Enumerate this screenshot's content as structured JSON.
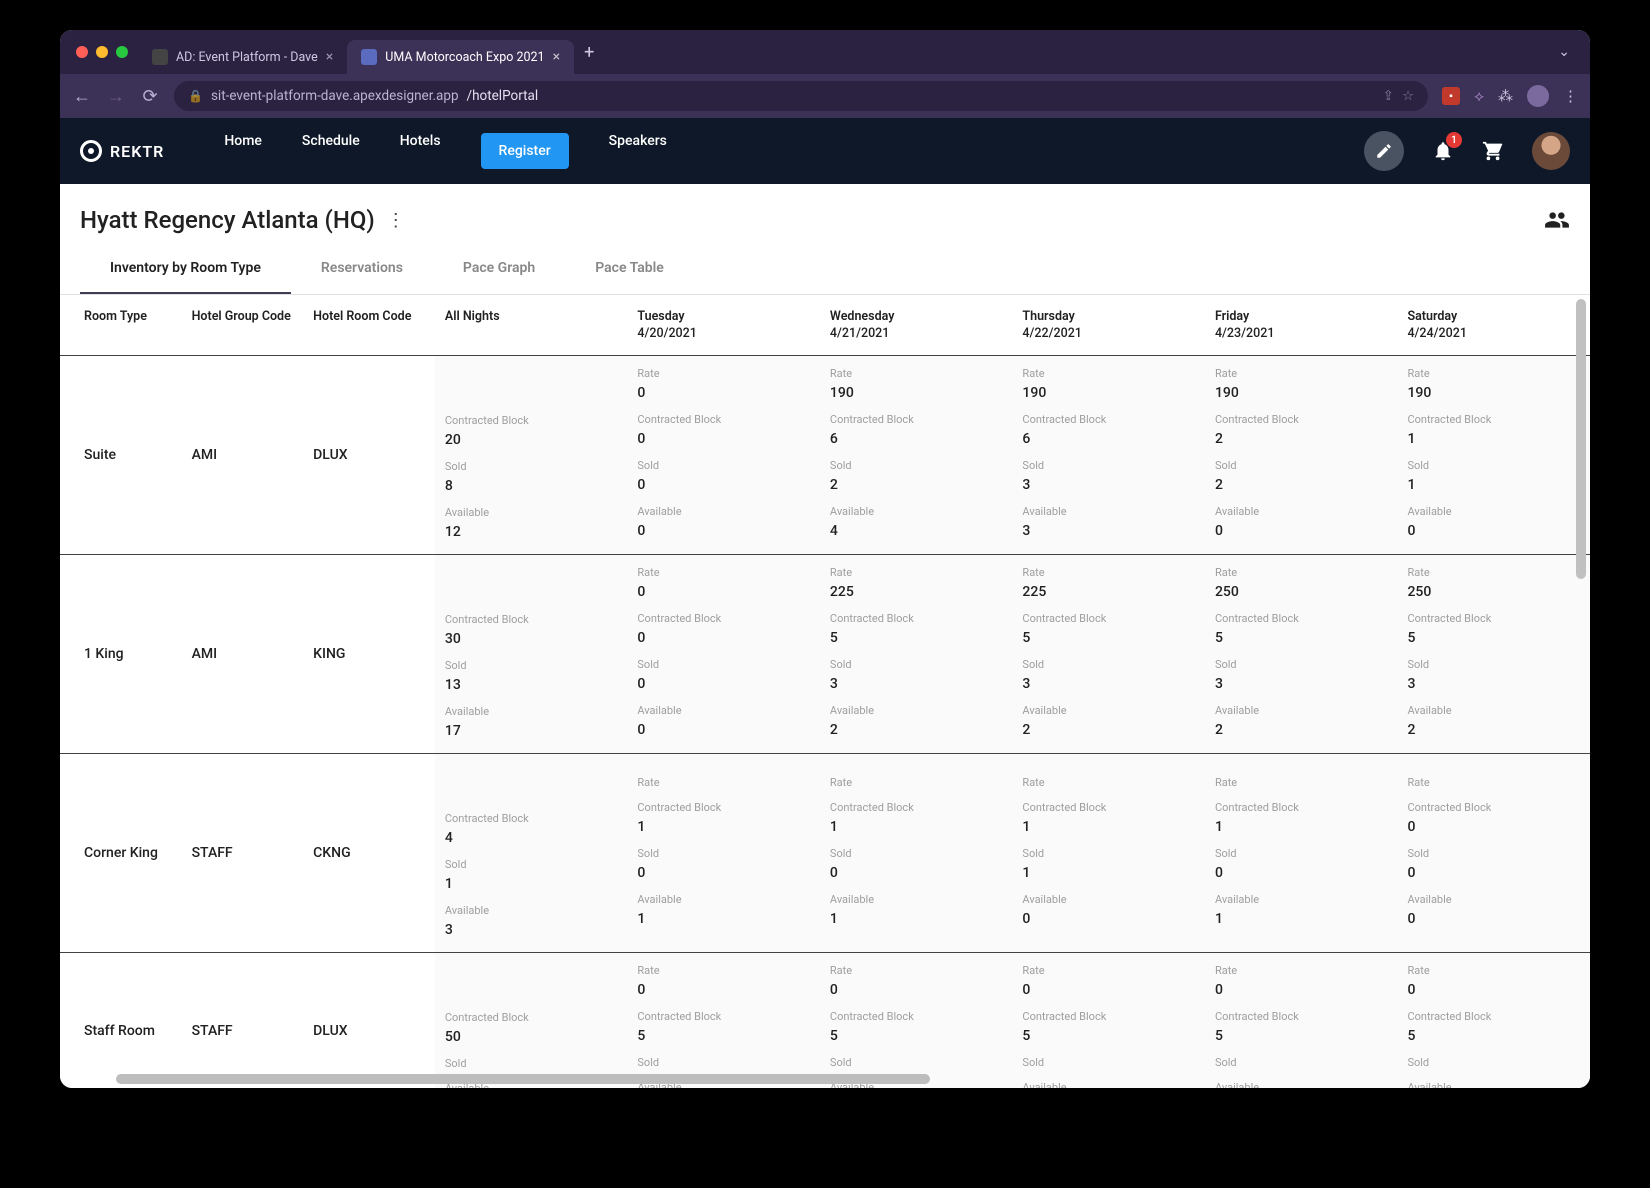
{
  "browser": {
    "tabs": [
      {
        "title": "AD: Event Platform - Dave",
        "active": false
      },
      {
        "title": "UMA Motorcoach Expo 2021",
        "active": true
      }
    ],
    "url_host": "sit-event-platform-dave.apexdesigner.app",
    "url_path": "/hotelPortal"
  },
  "header": {
    "brand": "REKTR",
    "nav": {
      "home": "Home",
      "schedule": "Schedule",
      "hotels": "Hotels",
      "register": "Register",
      "speakers": "Speakers"
    },
    "notification_count": "1"
  },
  "page": {
    "title": "Hyatt Regency Atlanta (HQ)",
    "tabs": {
      "inventory": "Inventory by Room Type",
      "reservations": "Reservations",
      "pace_graph": "Pace Graph",
      "pace_table": "Pace Table"
    }
  },
  "table": {
    "headers": {
      "room_type": "Room Type",
      "hotel_group_code": "Hotel Group Code",
      "hotel_room_code": "Hotel Room Code",
      "all_nights": "All Nights"
    },
    "day_columns": [
      {
        "day": "Tuesday",
        "date": "4/20/2021"
      },
      {
        "day": "Wednesday",
        "date": "4/21/2021"
      },
      {
        "day": "Thursday",
        "date": "4/22/2021"
      },
      {
        "day": "Friday",
        "date": "4/23/2021"
      },
      {
        "day": "Saturday",
        "date": "4/24/2021"
      }
    ],
    "metric_labels": {
      "rate": "Rate",
      "contracted": "Contracted Block",
      "sold": "Sold",
      "available": "Available"
    },
    "rooms": [
      {
        "room_type": "Suite",
        "group_code": "AMI",
        "room_code": "DLUX",
        "all_nights": {
          "contracted": "20",
          "sold": "8",
          "available": "12"
        },
        "days": [
          {
            "rate": "0",
            "contracted": "0",
            "sold": "0",
            "available": "0"
          },
          {
            "rate": "190",
            "contracted": "6",
            "sold": "2",
            "available": "4"
          },
          {
            "rate": "190",
            "contracted": "6",
            "sold": "3",
            "available": "3"
          },
          {
            "rate": "190",
            "contracted": "2",
            "sold": "2",
            "available": "0"
          },
          {
            "rate": "190",
            "contracted": "1",
            "sold": "1",
            "available": "0"
          }
        ]
      },
      {
        "room_type": "1 King",
        "group_code": "AMI",
        "room_code": "KING",
        "all_nights": {
          "contracted": "30",
          "sold": "13",
          "available": "17"
        },
        "days": [
          {
            "rate": "0",
            "contracted": "0",
            "sold": "0",
            "available": "0"
          },
          {
            "rate": "225",
            "contracted": "5",
            "sold": "3",
            "available": "2"
          },
          {
            "rate": "225",
            "contracted": "5",
            "sold": "3",
            "available": "2"
          },
          {
            "rate": "250",
            "contracted": "5",
            "sold": "3",
            "available": "2"
          },
          {
            "rate": "250",
            "contracted": "5",
            "sold": "3",
            "available": "2"
          }
        ]
      },
      {
        "room_type": "Corner King",
        "group_code": "STAFF",
        "room_code": "CKNG",
        "all_nights": {
          "contracted": "4",
          "sold": "1",
          "available": "3"
        },
        "days": [
          {
            "rate": "",
            "contracted": "1",
            "sold": "0",
            "available": "1"
          },
          {
            "rate": "",
            "contracted": "1",
            "sold": "0",
            "available": "1"
          },
          {
            "rate": "",
            "contracted": "1",
            "sold": "1",
            "available": "0"
          },
          {
            "rate": "",
            "contracted": "1",
            "sold": "0",
            "available": "1"
          },
          {
            "rate": "",
            "contracted": "0",
            "sold": "0",
            "available": "0"
          }
        ]
      },
      {
        "room_type": "Staff Room",
        "group_code": "STAFF",
        "room_code": "DLUX",
        "all_nights": {
          "contracted": "50",
          "sold": "",
          "available": ""
        },
        "days": [
          {
            "rate": "0",
            "contracted": "5",
            "sold": "",
            "available": ""
          },
          {
            "rate": "0",
            "contracted": "5",
            "sold": "",
            "available": ""
          },
          {
            "rate": "0",
            "contracted": "5",
            "sold": "",
            "available": ""
          },
          {
            "rate": "0",
            "contracted": "5",
            "sold": "",
            "available": ""
          },
          {
            "rate": "0",
            "contracted": "5",
            "sold": "",
            "available": ""
          }
        ]
      }
    ]
  }
}
